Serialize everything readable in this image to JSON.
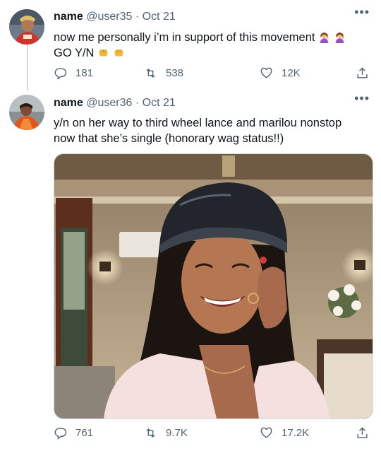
{
  "tweets": [
    {
      "name": "name",
      "handle": "@user35",
      "separator": "·",
      "date": "Oct 21",
      "more": "•••",
      "text": "now me personally i’m in support of this movement",
      "emojis_after_text": [
        "woman-tipping-hand",
        "woman-tipping-hand"
      ],
      "text_tail": "GO Y/N",
      "emojis_end": [
        "oncoming-fist",
        "oncoming-fist"
      ],
      "replies": "181",
      "retweets": "538",
      "likes": "12K"
    },
    {
      "name": "name",
      "handle": "@user36",
      "separator": "·",
      "date": "Oct 21",
      "more": "•••",
      "text": "y/n on her way to third wheel lance and marilou nonstop now that she’s single (honorary wag status!!)",
      "media": "photo-smiling-woman-satin-bonnet",
      "replies": "761",
      "retweets": "9.7K",
      "likes": "17.2K"
    }
  ],
  "colors": {
    "text": "#0f1419",
    "muted": "#536471",
    "line": "#cfd9de"
  },
  "icons": [
    "reply-icon",
    "retweet-icon",
    "like-icon",
    "share-icon",
    "more-icon"
  ]
}
